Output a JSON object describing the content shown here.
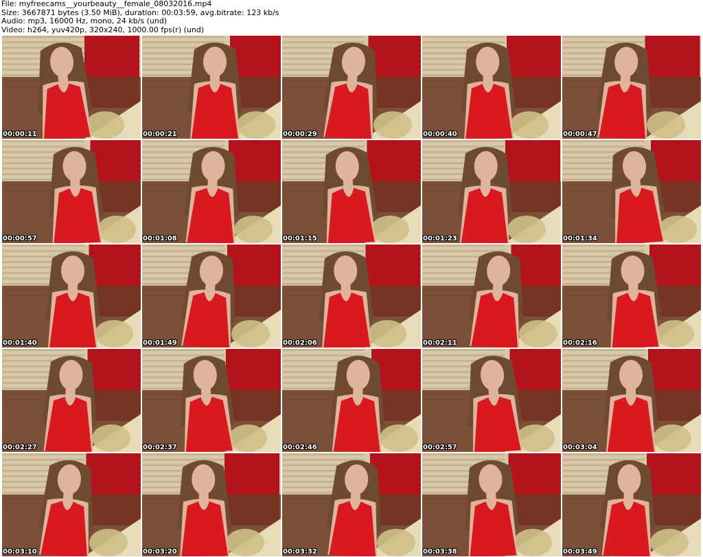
{
  "header": {
    "file_line": "File: myfreecams__yourbeauty__female_08032016.mp4",
    "size_line": "Size: 3667871 bytes (3.50 MiB), duration: 00:03:59, avg.bitrate: 123 kb/s",
    "audio_line": "Audio: mp3, 16000 Hz, mono, 24 kb/s (und)",
    "video_line": "Video: h264, yuv420p, 320x240, 1000.00 fps(r) (und)"
  },
  "thumbnails": [
    {
      "timestamp": "00:00:11"
    },
    {
      "timestamp": "00:00:21"
    },
    {
      "timestamp": "00:00:29"
    },
    {
      "timestamp": "00:00:40"
    },
    {
      "timestamp": "00:00:47"
    },
    {
      "timestamp": "00:00:57"
    },
    {
      "timestamp": "00:01:08"
    },
    {
      "timestamp": "00:01:15"
    },
    {
      "timestamp": "00:01:23"
    },
    {
      "timestamp": "00:01:34"
    },
    {
      "timestamp": "00:01:40"
    },
    {
      "timestamp": "00:01:49"
    },
    {
      "timestamp": "00:02:06"
    },
    {
      "timestamp": "00:02:11"
    },
    {
      "timestamp": "00:02:16"
    },
    {
      "timestamp": "00:02:27"
    },
    {
      "timestamp": "00:02:37"
    },
    {
      "timestamp": "00:02:46"
    },
    {
      "timestamp": "00:02:57"
    },
    {
      "timestamp": "00:03:04"
    },
    {
      "timestamp": "00:03:10"
    },
    {
      "timestamp": "00:03:20"
    },
    {
      "timestamp": "00:03:32"
    },
    {
      "timestamp": "00:03:38"
    },
    {
      "timestamp": "00:03:49"
    }
  ],
  "colors": {
    "background": "#ffffff",
    "wall_red": "#b3141c",
    "wall_light": "#d9c8a6",
    "sofa_brown": "#6b3a26",
    "cushion": "#e6dcb8",
    "dress_red": "#d8191f",
    "skin": "#e0b49a",
    "hair": "#6e4a33"
  }
}
